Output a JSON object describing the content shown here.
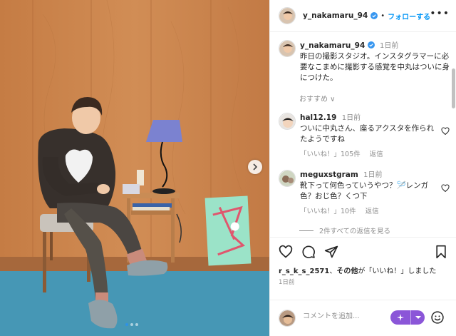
{
  "post": {
    "username": "y_nakamaru_94",
    "follow_label": "フォローする",
    "header_separator": "•",
    "more_label": "•••"
  },
  "caption": {
    "username": "y_nakamaru_94",
    "time": "1日前",
    "text": "昨日の撮影スタジオ。インスタグラマーに必要なこまめに撮影する感覚を中丸はついに身につけた。"
  },
  "recommended_label": "おすすめ ∨",
  "comments": [
    {
      "username": "hal12.19",
      "time": "1日前",
      "text": "ついに中丸さん、座るアクスタを作られたようですね",
      "likes": "「いいね！」105件",
      "reply_label": "返信"
    },
    {
      "username": "meguxstgram",
      "time": "1日前",
      "text": "靴下って何色っていうやつ？🪡レンガ色？おじ色？くつ下",
      "likes": "「いいね！」10件",
      "reply_label": "返信"
    }
  ],
  "view_replies_label": "2件すべての返信を見る",
  "likes_line": {
    "user": "r_s_k_s_2571",
    "mid": "、",
    "others": "その他",
    "suffix": "が「いいね！」しました"
  },
  "post_date": "1日前",
  "add_comment": {
    "placeholder": "コメントを追加..."
  },
  "carousel": {
    "dot_count": 3,
    "active_index": 0
  },
  "colors": {
    "accent": "#0095f6",
    "verified": "#3897f0",
    "ai_button": "#8b56d8",
    "wood": "#c9834d",
    "carpet": "#4a9bb8"
  },
  "icons": [
    "chevron-right-icon",
    "heart-icon",
    "comment-icon",
    "share-icon",
    "bookmark-icon",
    "sparkle-icon",
    "caret-down-icon",
    "emoji-icon",
    "verified-icon"
  ]
}
